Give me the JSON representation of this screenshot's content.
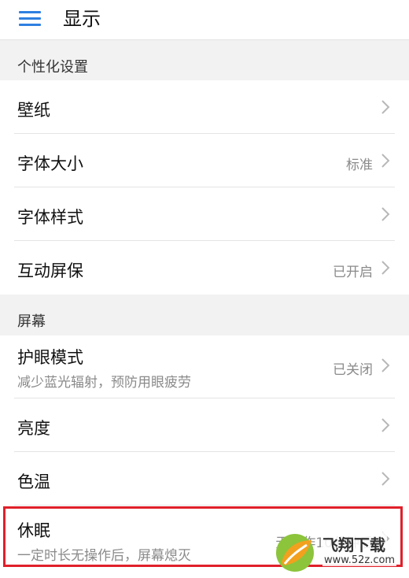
{
  "header": {
    "title": "显示",
    "menu_icon": "menu-icon",
    "accent_color": "#2f80e0"
  },
  "sections": [
    {
      "label": "个性化设置",
      "items": [
        {
          "title": "壁纸",
          "value": "",
          "icon": "chevron-right-icon"
        },
        {
          "title": "字体大小",
          "value": "标准",
          "icon": "chevron-right-icon"
        },
        {
          "title": "字体样式",
          "value": "",
          "icon": "chevron-right-icon"
        },
        {
          "title": "互动屏保",
          "value": "已开启",
          "icon": "chevron-right-icon"
        }
      ]
    },
    {
      "label": "屏幕",
      "items": [
        {
          "title": "护眼模式",
          "subtitle": "减少蓝光辐射，预防用眼疲劳",
          "value": "已关闭",
          "icon": "chevron-right-icon"
        },
        {
          "title": "亮度",
          "value": "",
          "icon": "chevron-right-icon"
        },
        {
          "title": "色温",
          "value": "",
          "icon": "chevron-right-icon"
        },
        {
          "title": "休眠",
          "subtitle": "一定时长无操作后，屏幕熄灭",
          "value": "无操作10分钟后",
          "icon": "chevron-right-icon"
        }
      ]
    }
  ],
  "highlight_color": "#e0202a",
  "watermark": {
    "name": "飞翔下载",
    "url": "www.52z.com"
  }
}
